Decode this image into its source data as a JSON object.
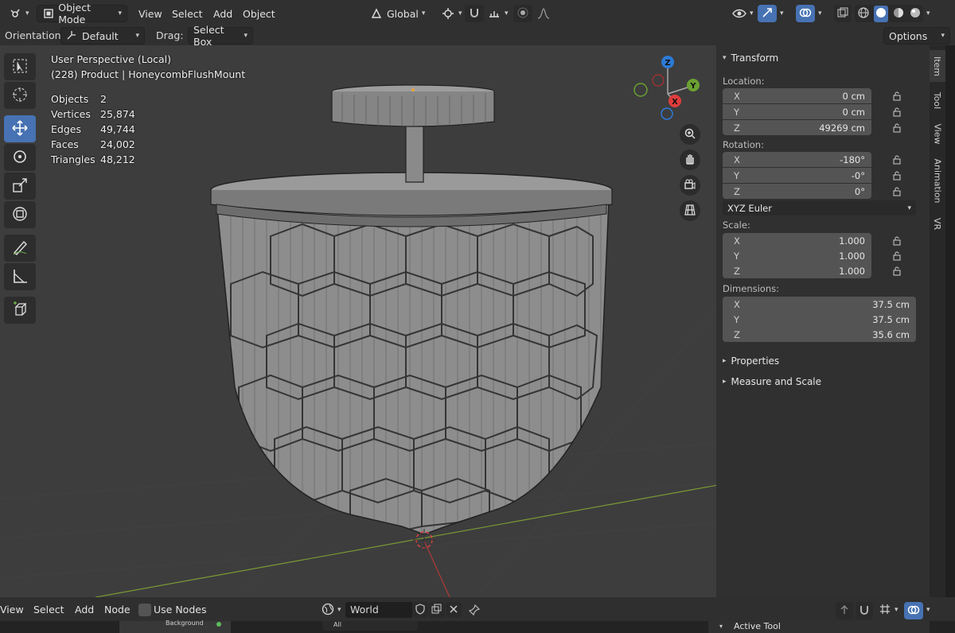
{
  "header": {
    "mode_label": "Object Mode",
    "menu": [
      "View",
      "Select",
      "Add",
      "Object"
    ],
    "transform_orientation": "Global",
    "accent_color": "#4772b3"
  },
  "tool_settings": {
    "orientation_label": "Orientation:",
    "orientation_value": "Default",
    "drag_label": "Drag:",
    "drag_value": "Select Box",
    "options_label": "Options"
  },
  "viewport": {
    "view_name": "User Perspective (Local)",
    "object_name": "(228) Product | HoneycombFlushMount",
    "stats": [
      {
        "label": "Objects",
        "value": "2"
      },
      {
        "label": "Vertices",
        "value": "25,874"
      },
      {
        "label": "Edges",
        "value": "49,744"
      },
      {
        "label": "Faces",
        "value": "24,002"
      },
      {
        "label": "Triangles",
        "value": "48,212"
      }
    ],
    "gizmo": {
      "z": "Z",
      "y": "Y",
      "x": "X"
    }
  },
  "sidebar": {
    "transform_title": "Transform",
    "location_label": "Location:",
    "location": [
      {
        "axis": "X",
        "value": "0 cm"
      },
      {
        "axis": "Y",
        "value": "0 cm"
      },
      {
        "axis": "Z",
        "value": "49269 cm"
      }
    ],
    "rotation_label": "Rotation:",
    "rotation": [
      {
        "axis": "X",
        "value": "-180°"
      },
      {
        "axis": "Y",
        "value": "-0°"
      },
      {
        "axis": "Z",
        "value": "0°"
      }
    ],
    "rotation_mode": "XYZ Euler",
    "scale_label": "Scale:",
    "scale": [
      {
        "axis": "X",
        "value": "1.000"
      },
      {
        "axis": "Y",
        "value": "1.000"
      },
      {
        "axis": "Z",
        "value": "1.000"
      }
    ],
    "dimensions_label": "Dimensions:",
    "dimensions": [
      {
        "axis": "X",
        "value": "37.5 cm"
      },
      {
        "axis": "Y",
        "value": "37.5 cm"
      },
      {
        "axis": "Z",
        "value": "35.6 cm"
      }
    ],
    "properties_title": "Properties",
    "measure_title": "Measure and Scale"
  },
  "tabs": [
    "Item",
    "Tool",
    "View",
    "Animation",
    "VR"
  ],
  "bottom_bar": {
    "menu": [
      "View",
      "Select",
      "Add",
      "Node"
    ],
    "use_nodes_label": "Use Nodes",
    "world_name": "World",
    "background_label": "Background",
    "all_label": "All",
    "active_tool_label": "Active Tool"
  }
}
